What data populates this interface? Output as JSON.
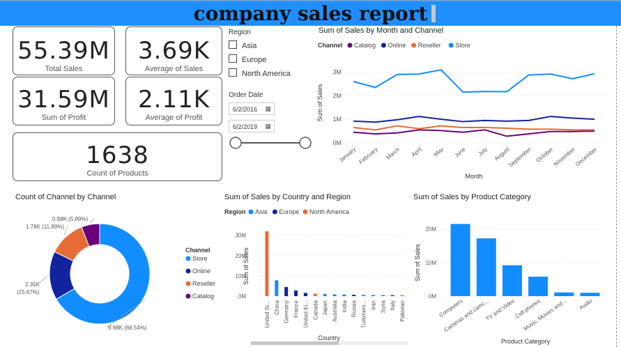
{
  "header": {
    "title": "company sales report"
  },
  "kpis": {
    "total_sales": {
      "value": "55.39M",
      "label": "Total Sales"
    },
    "avg_sales": {
      "value": "3.69K",
      "label": "Average of Sales"
    },
    "sum_profit": {
      "value": "31.59M",
      "label": "Sum of Profit"
    },
    "avg_profit": {
      "value": "2.11K",
      "label": "Average of Profit"
    },
    "count_products": {
      "value": "1638",
      "label": "Count of Products"
    }
  },
  "region_slicer": {
    "title": "Region",
    "items": [
      "Asia",
      "Europe",
      "North America"
    ]
  },
  "date_slicer": {
    "title": "Order Date",
    "start": "6/2/2016",
    "end": "6/2/2019",
    "range_fraction": [
      0,
      1
    ]
  },
  "colors": {
    "catalog": "#6B007B",
    "online": "#12239E",
    "reseller": "#E66C37",
    "store": "#118DFF",
    "header": "#1F8FFF"
  },
  "chart_data": [
    {
      "type": "line",
      "title": "Sum of Sales by Month and Channel",
      "legend_title": "Channel",
      "xlabel": "Month",
      "ylabel": "Sum of Sales",
      "categories": [
        "January",
        "February",
        "March",
        "April",
        "May",
        "June",
        "July",
        "August",
        "September",
        "October",
        "November",
        "December"
      ],
      "y_ticks": [
        "0M",
        "1M",
        "2M",
        "3M"
      ],
      "ylim": [
        0,
        3.4
      ],
      "series": [
        {
          "name": "Catalog",
          "values": [
            0.45,
            0.38,
            0.42,
            0.55,
            0.52,
            0.45,
            0.55,
            0.28,
            0.38,
            0.48,
            0.48,
            0.5
          ]
        },
        {
          "name": "Online",
          "values": [
            0.92,
            0.88,
            0.98,
            1.12,
            1.0,
            0.9,
            0.95,
            0.92,
            0.95,
            1.12,
            1.05,
            1.0
          ]
        },
        {
          "name": "Reseller",
          "values": [
            0.65,
            0.55,
            0.72,
            0.6,
            0.72,
            0.65,
            0.65,
            0.62,
            0.58,
            0.58,
            0.55,
            0.55
          ]
        },
        {
          "name": "Store",
          "values": [
            2.6,
            2.35,
            2.9,
            2.92,
            3.1,
            2.15,
            2.18,
            2.17,
            2.88,
            2.92,
            2.72,
            2.93
          ]
        }
      ]
    },
    {
      "type": "pie",
      "title": "Count of Channel by Channel",
      "legend_title": "Channel",
      "slices": [
        {
          "name": "Store",
          "value": 9.98,
          "label": "9.98K (66.54%)"
        },
        {
          "name": "Online",
          "value": 2.35,
          "label": "2.35K (15.67%)"
        },
        {
          "name": "Reseller",
          "value": 1.78,
          "label": "1.78K (11.89%)"
        },
        {
          "name": "Catalog",
          "value": 0.88,
          "label": "0.88K (5.89%)"
        }
      ]
    },
    {
      "type": "bar",
      "title": "Sum of Sales by Country and Region",
      "legend_title": "Region",
      "legend": [
        "Asia",
        "Europe",
        "North America"
      ],
      "xlabel": "Country",
      "ylabel": "Sum of Sales",
      "y_ticks": [
        "0M",
        "10M",
        "20M",
        "30M"
      ],
      "ylim": [
        0,
        33
      ],
      "categories": [
        "United St...",
        "China",
        "Germany",
        "France",
        "United Ki...",
        "Canada",
        "Japan",
        "Australia",
        "India",
        "Russia",
        "Turkmeni...",
        "Iran",
        "Syria",
        "Italy",
        "Pakistan"
      ],
      "bars": [
        {
          "region": "North America",
          "value": 32
        },
        {
          "region": "Asia",
          "value": 7.8
        },
        {
          "region": "Europe",
          "value": 4.5
        },
        {
          "region": "Europe",
          "value": 2.8
        },
        {
          "region": "Europe",
          "value": 1.6
        },
        {
          "region": "North America",
          "value": 1.2
        },
        {
          "region": "Asia",
          "value": 1.1
        },
        {
          "region": "Asia",
          "value": 0.9
        },
        {
          "region": "Asia",
          "value": 0.8
        },
        {
          "region": "Europe",
          "value": 0.7
        },
        {
          "region": "Asia",
          "value": 0.6
        },
        {
          "region": "Asia",
          "value": 0.55
        },
        {
          "region": "Asia",
          "value": 0.5
        },
        {
          "region": "Europe",
          "value": 0.45
        },
        {
          "region": "Asia",
          "value": 0.4
        }
      ]
    },
    {
      "type": "bar",
      "title": "Sum of Sales by Product Category",
      "xlabel": "Product Category",
      "ylabel": "Sum of Sales",
      "y_ticks": [
        "0M",
        "10M",
        "20M"
      ],
      "ylim": [
        0,
        22
      ],
      "categories": [
        "Computers",
        "Cameras and camc...",
        "TV and Video",
        "Cell phones",
        "Music, Movies and...",
        "Audio"
      ],
      "values": [
        21.5,
        17.2,
        9.2,
        5.8,
        1.1,
        1.0
      ]
    }
  ]
}
